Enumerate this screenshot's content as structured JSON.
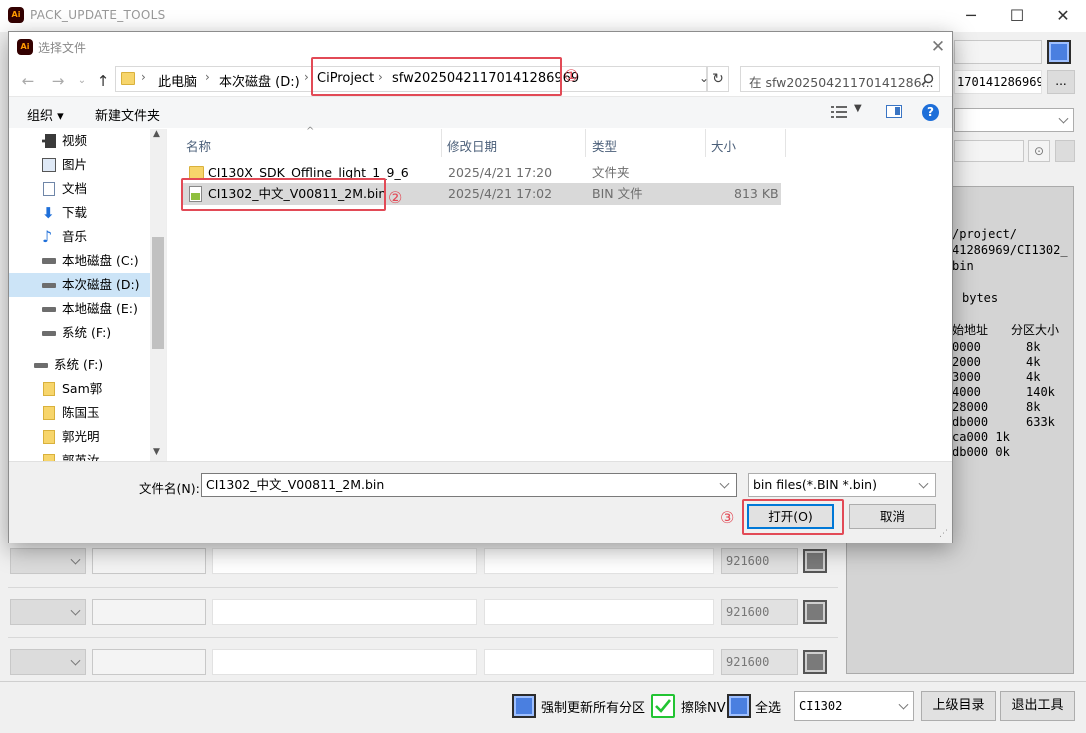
{
  "main_window": {
    "title": "PACK_UPDATE_TOOLS",
    "app_icon_text": "Ai",
    "controls": {
      "minimize": "─",
      "maximize": "☐",
      "close": "✕"
    },
    "right_path_text": "170141286969",
    "browse_label": "...",
    "log_lines": [
      "/project/",
      "41286969/CI1302_",
      "bin",
      "bytes",
      "始地址",
      "分区大小",
      "0000",
      "8k",
      "2000",
      "4k",
      "3000",
      "4k",
      "4000",
      "140k",
      "28000",
      "8k",
      "db000",
      "633k",
      "ca000 1k",
      "db000 0k"
    ],
    "serial_rows": [
      {
        "baud": "921600"
      },
      {
        "baud": "921600"
      },
      {
        "baud": "921600"
      }
    ],
    "bottom": {
      "force_update_label": "强制更新所有分区",
      "erase_nv_label": "擦除NV",
      "select_all_label": "全选",
      "chip_value": "CI1302",
      "parent_dir_button": "上级目录",
      "exit_button": "退出工具"
    }
  },
  "dialog": {
    "title": "选择文件",
    "breadcrumbs": [
      "此电脑",
      "本次磁盘 (D:)",
      "CiProject",
      "sfw20250421170141286969"
    ],
    "search_placeholder": "在 sfw20250421170141286...",
    "toolbar": {
      "organize": "组织 ▾",
      "new_folder": "新建文件夹"
    },
    "nav_items": [
      {
        "label": "视频",
        "icon": "video-icon"
      },
      {
        "label": "图片",
        "icon": "picture-icon"
      },
      {
        "label": "文档",
        "icon": "document-icon"
      },
      {
        "label": "下载",
        "icon": "download-icon"
      },
      {
        "label": "音乐",
        "icon": "music-icon"
      },
      {
        "label": "本地磁盘 (C:)",
        "icon": "drive-icon"
      },
      {
        "label": "本次磁盘 (D:)",
        "icon": "drive-icon"
      },
      {
        "label": "本地磁盘 (E:)",
        "icon": "drive-icon"
      },
      {
        "label": "系统 (F:)",
        "icon": "drive-icon"
      },
      {
        "label": "系统 (F:)",
        "icon": "drive-icon"
      },
      {
        "label": "Sam郭",
        "icon": "folder-icon"
      },
      {
        "label": "陈国玉",
        "icon": "folder-icon"
      },
      {
        "label": "郭光明",
        "icon": "folder-icon"
      },
      {
        "label": "郭英汝",
        "icon": "folder-icon"
      }
    ],
    "columns": {
      "name": "名称",
      "modified": "修改日期",
      "type": "类型",
      "size": "大小"
    },
    "files": [
      {
        "name": "CI130X_SDK_Offline_light_1_9_6",
        "modified": "2025/4/21 17:20",
        "type": "文件夹",
        "size": ""
      },
      {
        "name": "CI1302_中文_V00811_2M.bin",
        "modified": "2025/4/21 17:02",
        "type": "BIN 文件",
        "size": "813 KB"
      }
    ],
    "filename_label": "文件名(N):",
    "filename_value": "CI1302_中文_V00811_2M.bin",
    "filter_value": "bin files(*.BIN *.bin)",
    "open_button": "打开(O)",
    "cancel_button": "取消"
  },
  "annotations": {
    "one": "①",
    "two": "②",
    "three": "③"
  },
  "colors": {
    "accent_blue": "#4a7fe0",
    "annotation_red": "#e24a56",
    "check_green": "#22c433"
  }
}
